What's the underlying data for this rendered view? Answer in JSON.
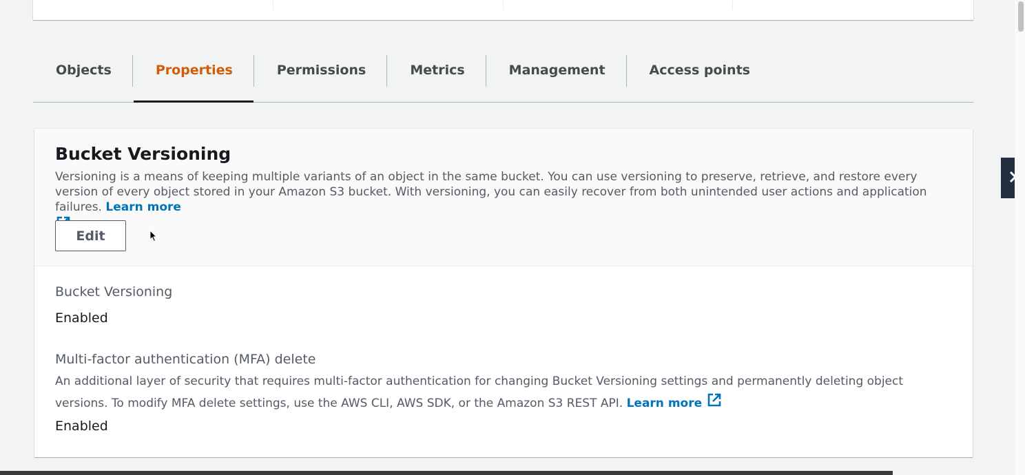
{
  "tabs": [
    {
      "label": "Objects",
      "active": false
    },
    {
      "label": "Properties",
      "active": true
    },
    {
      "label": "Permissions",
      "active": false
    },
    {
      "label": "Metrics",
      "active": false
    },
    {
      "label": "Management",
      "active": false
    },
    {
      "label": "Access points",
      "active": false
    }
  ],
  "versioning_panel": {
    "title": "Bucket Versioning",
    "description": "Versioning is a means of keeping multiple variants of an object in the same bucket. You can use versioning to preserve, retrieve, and restore every version of every object stored in your Amazon S3 bucket. With versioning, you can easily recover from both unintended user actions and application failures.",
    "learn_more": "Learn more",
    "learn_more_icon": "external-link-icon",
    "edit_label": "Edit"
  },
  "fields": {
    "versioning": {
      "label": "Bucket Versioning",
      "value": "Enabled"
    },
    "mfa": {
      "label": "Multi-factor authentication (MFA) delete",
      "description": "An additional layer of security that requires multi-factor authentication for changing Bucket Versioning settings and permanently deleting object versions. To modify MFA delete settings, use the AWS CLI, AWS SDK, or the Amazon S3 REST API.",
      "learn_more": "Learn more",
      "value": "Enabled"
    }
  },
  "side_toggle_icon": "chevron-right-icon",
  "colors": {
    "active_tab": "#d45b07",
    "link": "#0073bb",
    "side_toggle_bg": "#232f3e"
  }
}
